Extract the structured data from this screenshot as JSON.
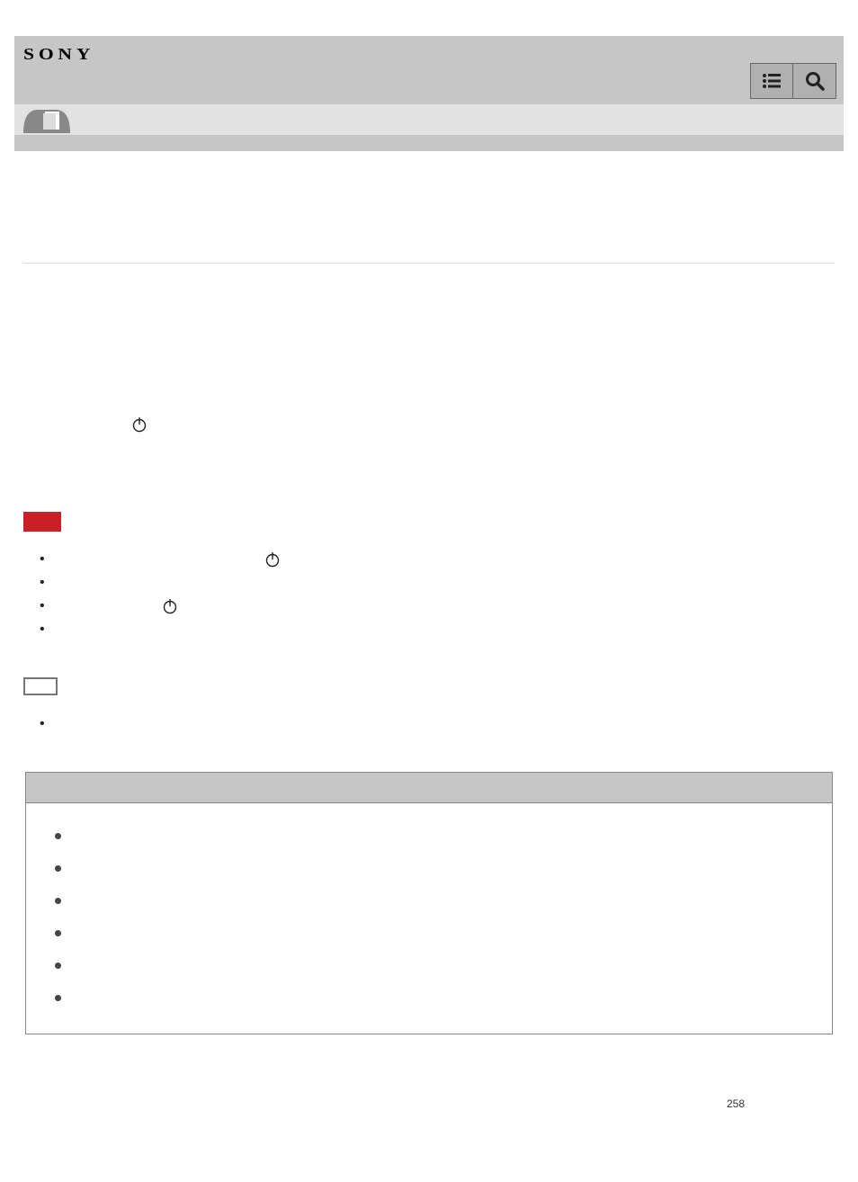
{
  "brand": "SONY",
  "header": {
    "list_icon": "list-icon",
    "search_icon": "search-icon",
    "tab_icon": "document-tab-icon"
  },
  "warning_badge_color": "#c92027",
  "bullet_items": [
    {
      "label": ""
    },
    {
      "label": ""
    },
    {
      "label": ""
    },
    {
      "label": ""
    }
  ],
  "note_box_label": "",
  "note_bullets": [
    {
      "label": ""
    }
  ],
  "table": {
    "header": "",
    "rows": [
      {
        "text": ""
      },
      {
        "text": ""
      },
      {
        "text": ""
      },
      {
        "text": ""
      },
      {
        "text": ""
      },
      {
        "text": ""
      }
    ]
  },
  "page_number": "258"
}
